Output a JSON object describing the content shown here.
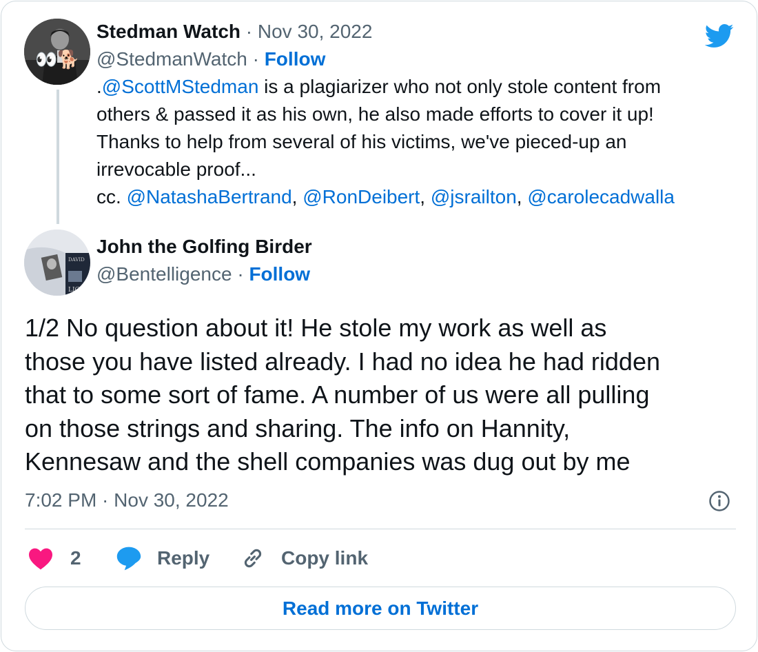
{
  "quoted_tweet": {
    "author_name": "Stedman Watch",
    "date_sep": "·",
    "date": "Nov 30, 2022",
    "handle": "@StedmanWatch",
    "follow_sep": "·",
    "follow_label": "Follow",
    "avatar_emoji": "👀🐕",
    "body": {
      "line1_prefix": ".",
      "line1_mention": "@ScottMStedman",
      "line1_rest": " is a plagiarizer who not only stole content from",
      "line2": "others & passed it as his own, he also made efforts to cover it up!",
      "line3": "Thanks to help from several of his victims, we've pieced-up an",
      "line4": "irrevocable proof...",
      "cc_prefix": "cc. ",
      "mentions": [
        "@NatashaBertrand",
        "@RonDeibert",
        "@jsrailton",
        "@carolecadwalla"
      ],
      "mention_sep": ", "
    }
  },
  "main_tweet": {
    "author_name": "John the Golfing Birder",
    "handle": "@Bentelligence",
    "follow_sep": "·",
    "follow_label": "Follow",
    "text_lines": [
      "1/2 No question about it! He stole my work as well as",
      "those you have listed already. I had no idea he had ridden",
      "that to some sort of fame. A number of us were all pulling",
      "on those strings and sharing. The info on Hannity,",
      "Kennesaw and the shell companies was dug out by me"
    ],
    "timestamp": "7:02 PM · Nov 30, 2022"
  },
  "actions": {
    "like_count": "2",
    "reply_label": "Reply",
    "copy_link_label": "Copy link"
  },
  "read_more_label": "Read more on Twitter",
  "icons": {
    "brand": "twitter-bird-icon",
    "info": "info-icon",
    "like": "heart-icon",
    "reply": "speech-bubble-icon",
    "copy": "link-icon"
  },
  "colors": {
    "brand": "#1d9bf0",
    "link": "#006fd6",
    "heart": "#f91880",
    "muted": "#536471",
    "border": "#cfd9de"
  }
}
